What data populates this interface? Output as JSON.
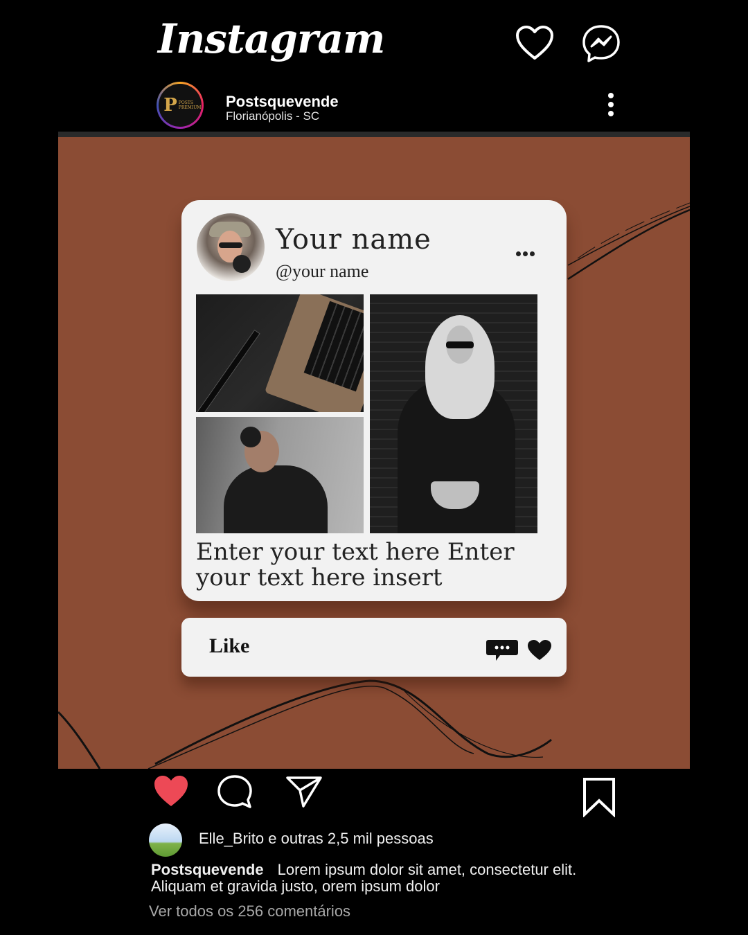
{
  "app": {
    "title": "Instagram"
  },
  "header": {
    "heart_icon": "heart-outline-icon",
    "messenger_icon": "messenger-icon"
  },
  "profile": {
    "name": "Postsquevende",
    "location": "Florianópolis - SC",
    "avatar_letter": "P",
    "avatar_caption": "POSTS PREMIUM"
  },
  "card": {
    "name": "Your name",
    "handle": "@your name",
    "text": "Enter your text here Enter your text here insert"
  },
  "likebar": {
    "label": "Like"
  },
  "colors": {
    "post_background": "#8b4c34",
    "card": "#f2f2f2",
    "liked_heart": "#ed4956"
  },
  "engagement": {
    "liked_by": "Elle_Brito e outras 2,5 mil pessoas",
    "caption_user": "Postsquevende",
    "caption_text": "Lorem ipsum dolor sit amet, consectetur elit. Aliquam et gravida justo, orem ipsum dolor",
    "view_comments": "Ver todos os 256 comentários"
  }
}
